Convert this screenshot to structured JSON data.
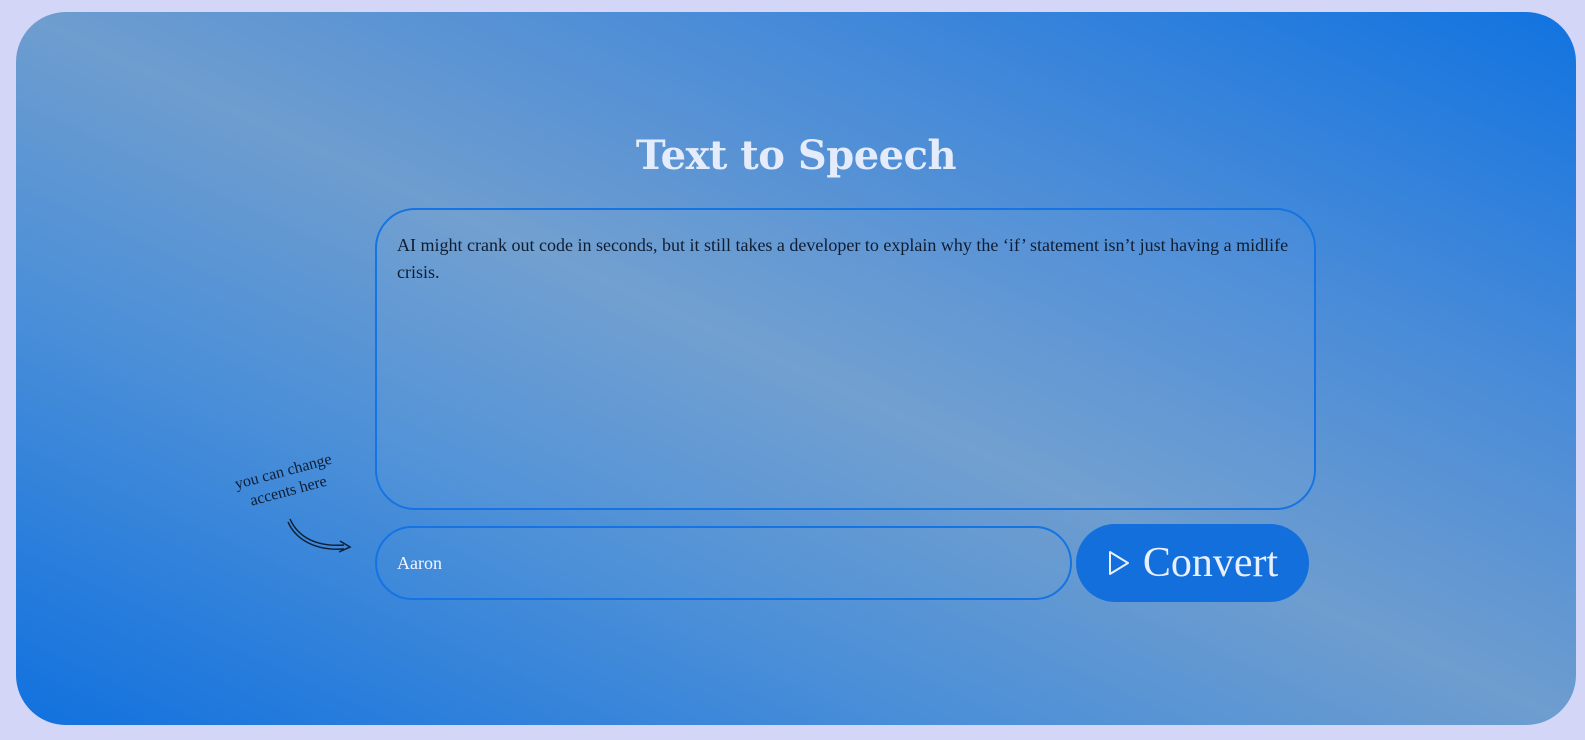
{
  "app": {
    "title": "Text to Speech"
  },
  "editor": {
    "text": "AI might crank out code in seconds, but it still takes a developer to explain why the ‘if’ statement isn’t just having a midlife crisis."
  },
  "voice": {
    "value": "Aaron"
  },
  "convert_button": {
    "label": "Convert",
    "icon": "play-icon"
  },
  "hint": {
    "text": "you can change accents here"
  },
  "colors": {
    "page_background": "#d3d6f6",
    "accent": "#126fdc",
    "border": "#1573e2",
    "title": "#e4ecfb"
  }
}
